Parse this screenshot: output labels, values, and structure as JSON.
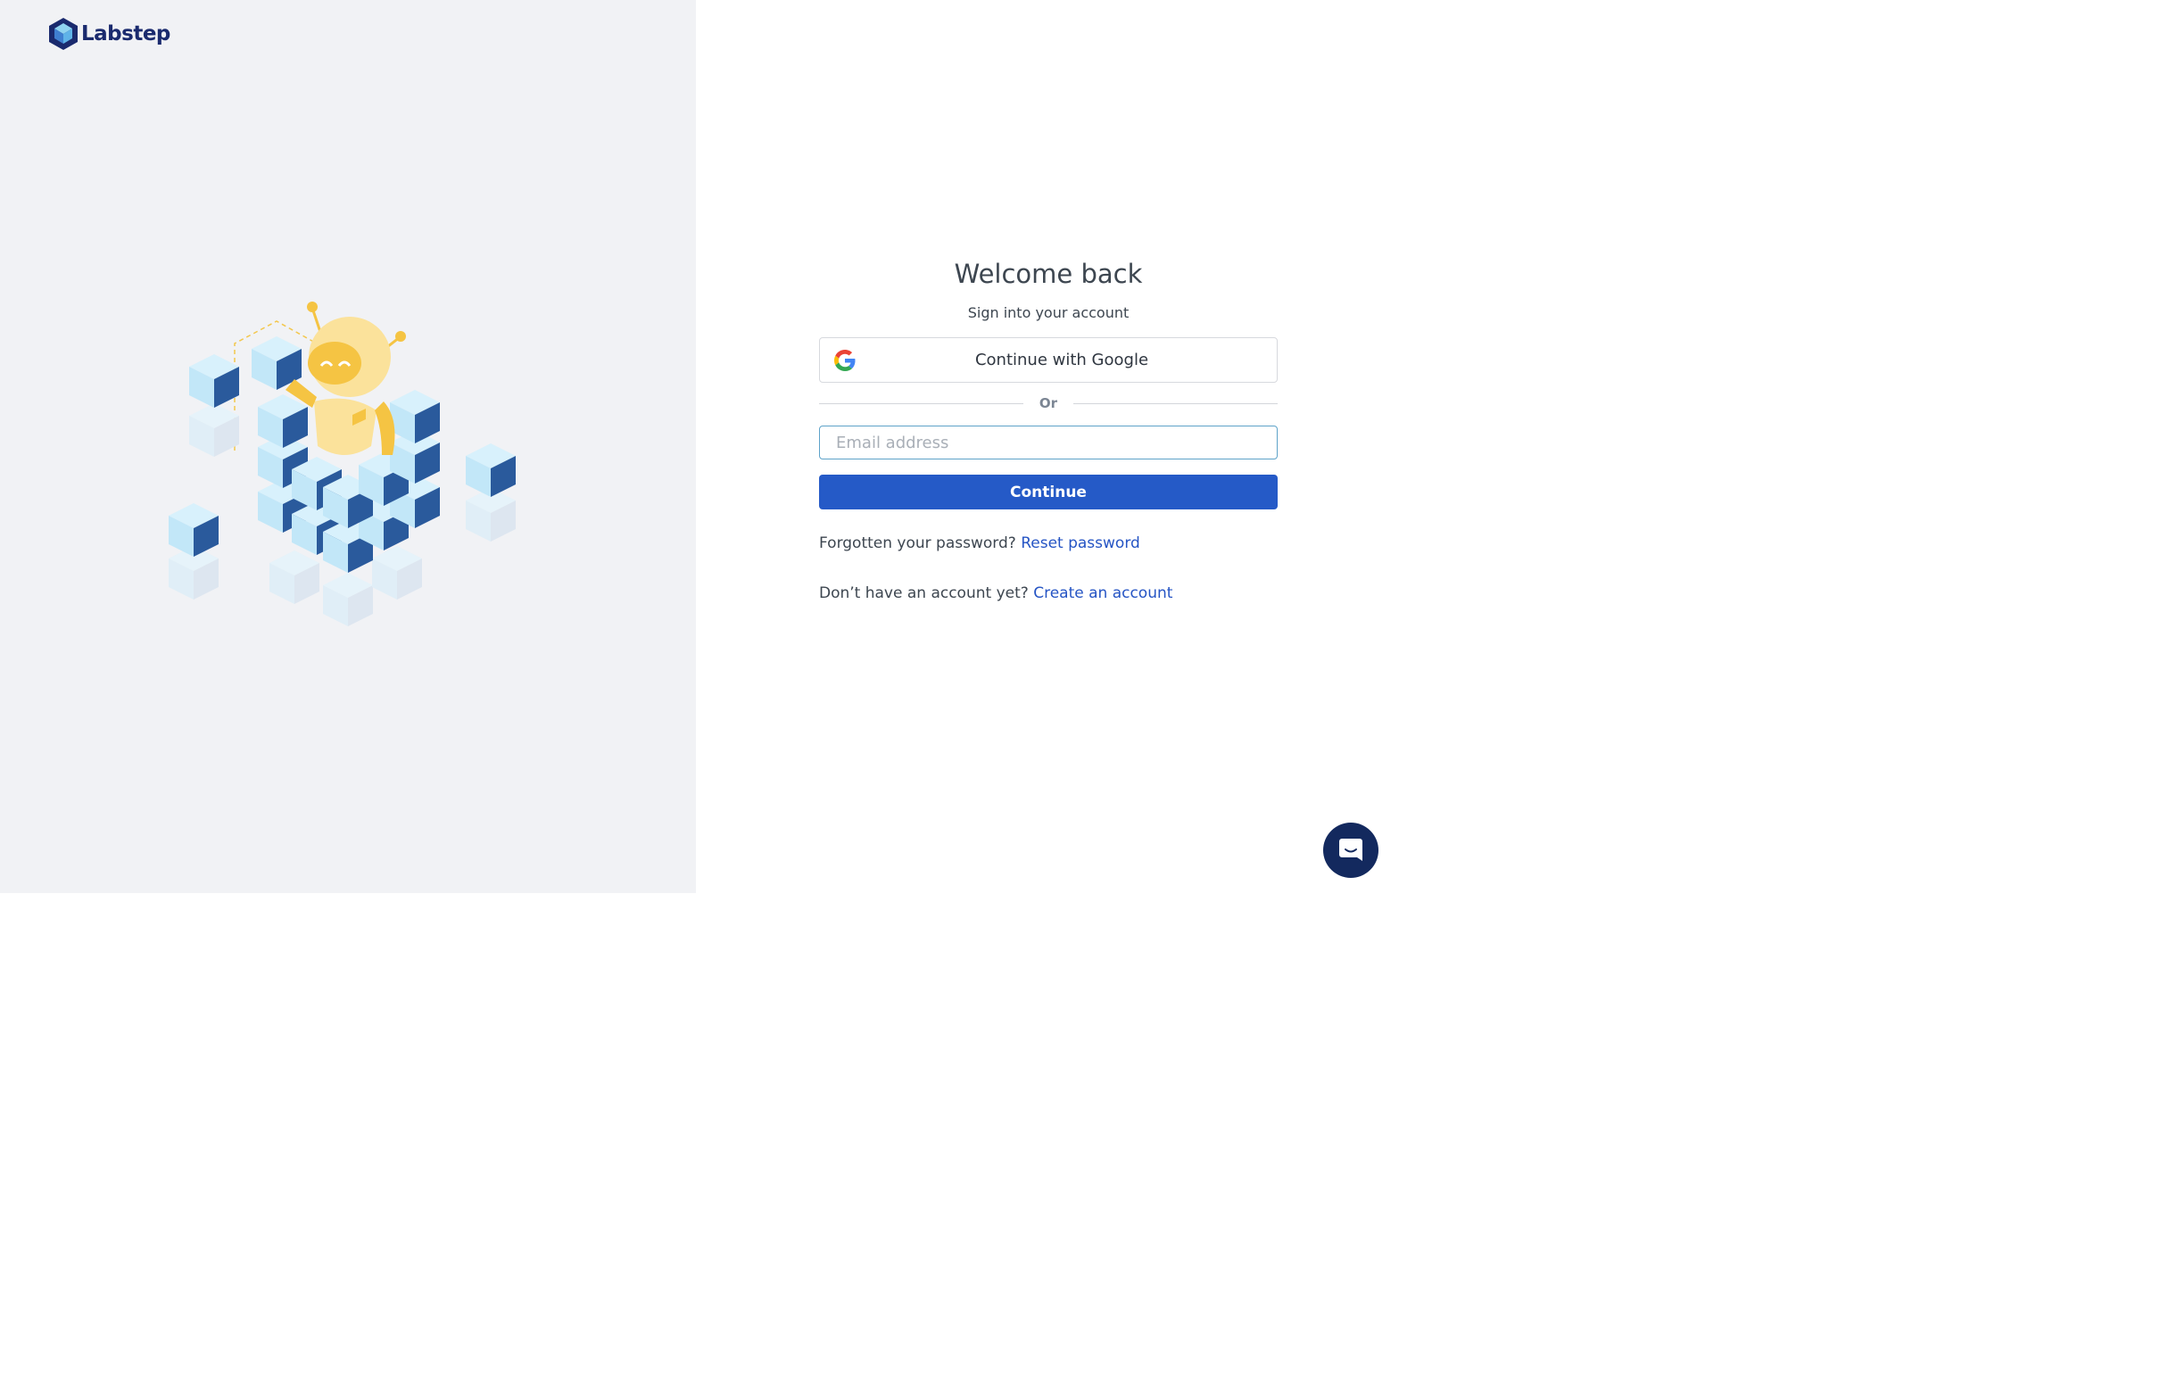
{
  "brand": {
    "name": "Labstep"
  },
  "login": {
    "title": "Welcome back",
    "subtitle": "Sign into your account",
    "google_button_label": "Continue with Google",
    "divider_text": "Or",
    "email_placeholder": "Email address",
    "email_value": "",
    "continue_label": "Continue",
    "forgot_prompt": "Forgotten your password?",
    "reset_link": "Reset password",
    "no_account_prompt": "Don’t have an account yet?",
    "create_account_link": "Create an account"
  },
  "colors": {
    "left_panel_bg": "#f1f2f5",
    "primary_button": "#255ac7",
    "link": "#2554c4",
    "brand_navy": "#13295e",
    "robot_yellow": "#f5c443"
  },
  "icons": {
    "logo": "labstep-cube-logo",
    "google": "google-g-icon",
    "chat": "chat-bubble-icon"
  }
}
